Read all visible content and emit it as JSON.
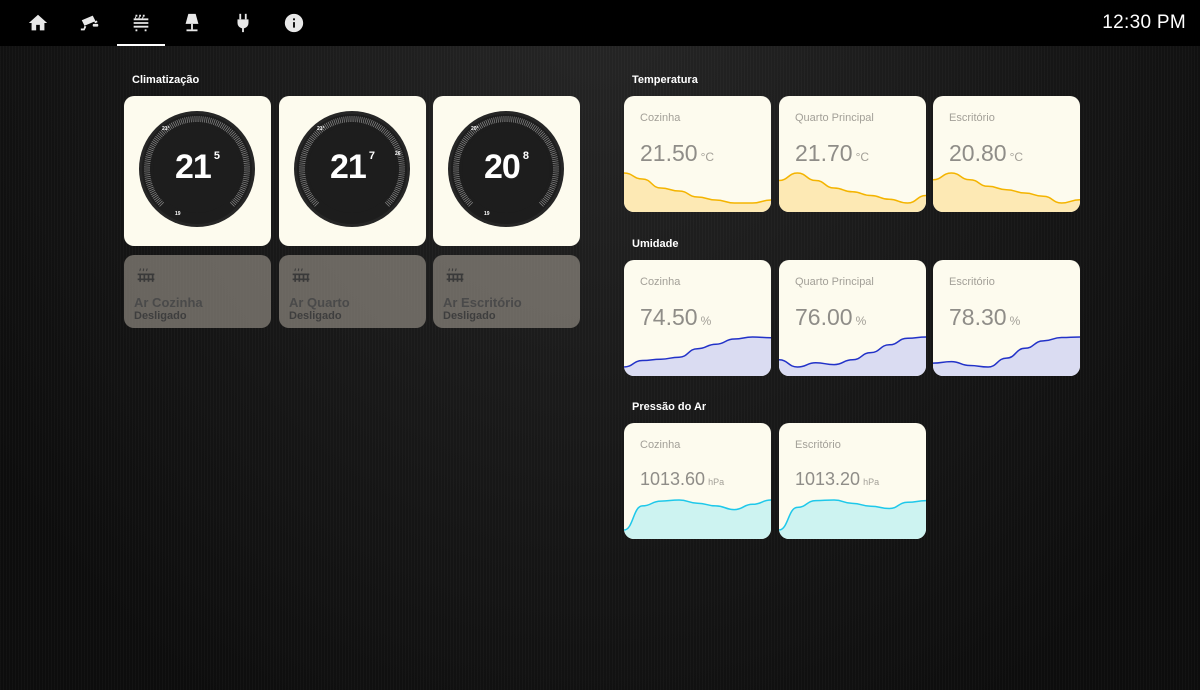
{
  "topbar": {
    "icons": [
      "home-icon",
      "cctv-camera-icon",
      "radiator-icon",
      "lamp-icon",
      "plug-icon",
      "info-icon"
    ],
    "active_index": 2,
    "clock": "12:30 PM"
  },
  "climatizacao": {
    "title": "Climatização",
    "thermostats": [
      {
        "int": "21",
        "dec": "5",
        "setpoint_label": "21°",
        "low_label": "19"
      },
      {
        "int": "21",
        "dec": "7",
        "setpoint_label": "21°",
        "high_label": "26"
      },
      {
        "int": "20",
        "dec": "8",
        "setpoint_label": "20°",
        "low_label": "19"
      }
    ],
    "ac_units": [
      {
        "name": "Ar Cozinha",
        "state": "Desligado"
      },
      {
        "name": "Ar Quarto",
        "state": "Desligado"
      },
      {
        "name": "Ar Escritório",
        "state": "Desligado"
      }
    ]
  },
  "temperatura": {
    "title": "Temperatura",
    "color": "#f4b400",
    "fill": "#fde9b4",
    "sensors": [
      {
        "name": "Cozinha",
        "value": "21.50",
        "unit": "°C",
        "trend": [
          22.0,
          21.9,
          21.75,
          21.7,
          21.6,
          21.55,
          21.5,
          21.5,
          21.55
        ]
      },
      {
        "name": "Quarto Principal",
        "value": "21.70",
        "unit": "°C",
        "trend": [
          21.9,
          22.0,
          21.9,
          21.8,
          21.75,
          21.7,
          21.65,
          21.6,
          21.7
        ]
      },
      {
        "name": "Escritório",
        "value": "20.80",
        "unit": "°C",
        "trend": [
          21.2,
          21.3,
          21.2,
          21.1,
          21.05,
          21.0,
          20.95,
          20.85,
          20.9
        ]
      }
    ]
  },
  "umidade": {
    "title": "Umidade",
    "color": "#2232c8",
    "fill": "#dadcf2",
    "sensors": [
      {
        "name": "Cozinha",
        "value": "74.50",
        "unit": "%",
        "trend": [
          70.0,
          71.0,
          71.2,
          71.5,
          72.8,
          73.5,
          74.3,
          74.6,
          74.5
        ]
      },
      {
        "name": "Quarto Principal",
        "value": "76.00",
        "unit": "%",
        "trend": [
          72.0,
          70.8,
          71.5,
          71.2,
          72.0,
          73.2,
          74.5,
          75.6,
          75.8
        ]
      },
      {
        "name": "Escritório",
        "value": "78.30",
        "unit": "%",
        "trend": [
          73.0,
          73.3,
          72.5,
          72.2,
          74.0,
          76.0,
          77.5,
          78.2,
          78.3
        ]
      }
    ]
  },
  "pressao": {
    "title": "Pressão do Ar",
    "color": "#1ec8ea",
    "fill": "#cdf3f1",
    "sensors": [
      {
        "name": "Cozinha",
        "value": "1013.60",
        "unit": "hPa",
        "trend": [
          1008.0,
          1012.5,
          1013.4,
          1013.6,
          1013.0,
          1012.5,
          1011.8,
          1012.8,
          1013.6
        ]
      },
      {
        "name": "Escritório",
        "value": "1013.20",
        "unit": "hPa",
        "trend": [
          1008.0,
          1012.0,
          1013.2,
          1013.3,
          1012.7,
          1012.2,
          1011.8,
          1012.9,
          1013.2
        ]
      }
    ]
  }
}
